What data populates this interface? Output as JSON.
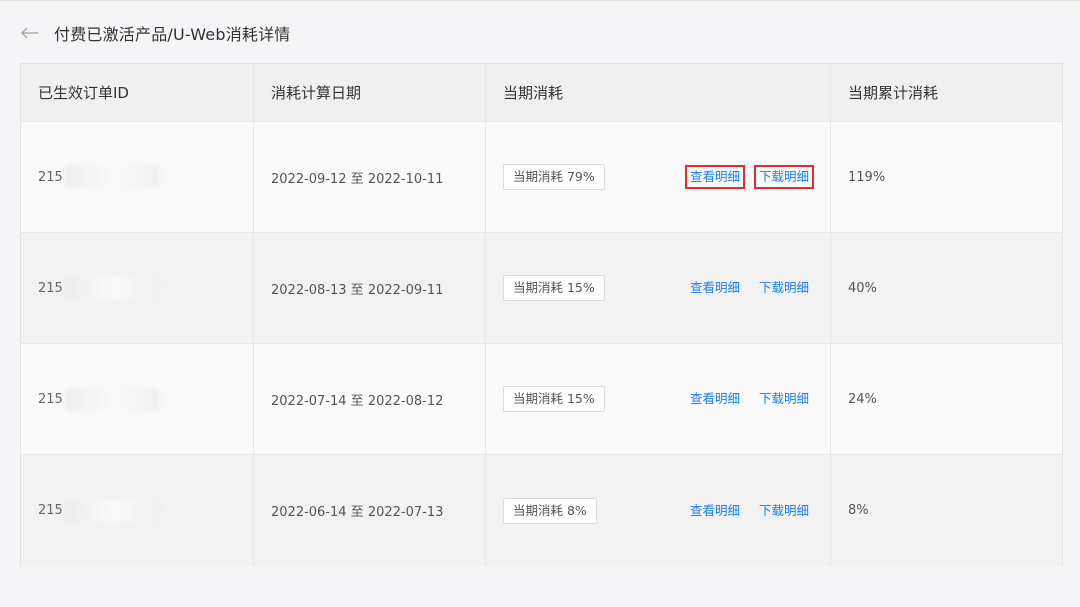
{
  "header": {
    "title": "付费已激活产品/U-Web消耗详情"
  },
  "table": {
    "columns": [
      "已生效订单ID",
      "消耗计算日期",
      "当期消耗",
      "当期累计消耗"
    ],
    "rows": [
      {
        "order_id": "215",
        "date_range": "2022-09-12 至 2022-10-11",
        "tag": "当期消耗 79%",
        "view": "查看明细",
        "download": "下载明细",
        "cumulative": "119%"
      },
      {
        "order_id": "215",
        "date_range": "2022-08-13 至 2022-09-11",
        "tag": "当期消耗 15%",
        "view": "查看明细",
        "download": "下载明细",
        "cumulative": "40%"
      },
      {
        "order_id": "215",
        "date_range": "2022-07-14 至 2022-08-12",
        "tag": "当期消耗 15%",
        "view": "查看明细",
        "download": "下载明细",
        "cumulative": "24%"
      },
      {
        "order_id": "215",
        "date_range": "2022-06-14 至 2022-07-13",
        "tag": "当期消耗 8%",
        "view": "查看明细",
        "download": "下载明细",
        "cumulative": "8%"
      }
    ]
  },
  "icons": {
    "back": "arrow-left-icon"
  },
  "colors": {
    "link": "#1a7ff0",
    "highlight_border": "#e52b2b"
  }
}
